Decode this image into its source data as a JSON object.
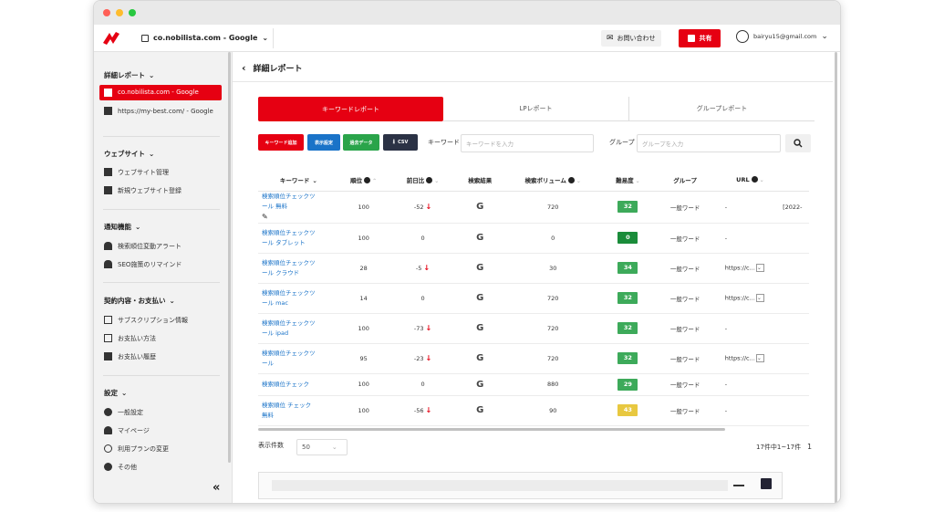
{
  "topbar": {
    "site_name": "co.nobilista.com - Google",
    "contact_label": "お問い合わせ",
    "share_label": "共有",
    "user_email": "bairyu15@gmail.com"
  },
  "sidebar": {
    "sections": [
      {
        "title": "詳細レポート",
        "items": [
          {
            "label": "co.nobilista.com - Google",
            "active": true
          },
          {
            "label": "https://my-best.com/ - Google",
            "active": false
          }
        ]
      },
      {
        "title": "ウェブサイト",
        "items": [
          {
            "label": "ウェブサイト管理"
          },
          {
            "label": "新規ウェブサイト登録"
          }
        ]
      },
      {
        "title": "通知機能",
        "items": [
          {
            "label": "検索順位変動アラート"
          },
          {
            "label": "SEO施策のリマインド"
          }
        ]
      },
      {
        "title": "契約内容・お支払い",
        "items": [
          {
            "label": "サブスクリプション情報"
          },
          {
            "label": "お支払い方法"
          },
          {
            "label": "お支払い履歴"
          }
        ]
      },
      {
        "title": "設定",
        "items": [
          {
            "label": "一般設定"
          },
          {
            "label": "マイページ"
          },
          {
            "label": "利用プランの変更"
          },
          {
            "label": "その他"
          }
        ]
      }
    ]
  },
  "main": {
    "title": "詳細レポート",
    "tabs": [
      "キーワードレポート",
      "LPレポート",
      "グループレポート"
    ],
    "buttons": {
      "add_keyword": "キーワード追加",
      "display_settings": "表示設定",
      "past_data": "過去データ",
      "csv": "CSV"
    },
    "filters": {
      "keyword_label": "キーワード",
      "keyword_placeholder": "キーワードを入力",
      "group_label": "グループ",
      "group_placeholder": "グループを入力"
    },
    "table": {
      "headers": [
        "キーワード",
        "順位",
        "前日比",
        "検索結果",
        "検索ボリューム",
        "難易度",
        "グループ",
        "URL"
      ],
      "rows": [
        {
          "kw1": "検索順位チェックツ",
          "kw2": "ール 無料",
          "rank": "100",
          "diff": "-52",
          "down": true,
          "volume": "720",
          "difficulty": "32",
          "dcolor": "#3daa5a",
          "group": "一般ワード",
          "url": "-",
          "extra": "[2022-"
        },
        {
          "kw1": "検索順位チェックツ",
          "kw2": "ール タブレット",
          "rank": "100",
          "diff": "0",
          "down": false,
          "volume": "0",
          "difficulty": "0",
          "dcolor": "#1a8c3a",
          "group": "一般ワード",
          "url": "-",
          "extra": ""
        },
        {
          "kw1": "検索順位チェックツ",
          "kw2": "ール クラウド",
          "rank": "28",
          "diff": "-5",
          "down": true,
          "volume": "30",
          "difficulty": "34",
          "dcolor": "#3daa5a",
          "group": "一般ワード",
          "url": "https://c...",
          "extra": ""
        },
        {
          "kw1": "検索順位チェックツ",
          "kw2": "ール mac",
          "rank": "14",
          "diff": "0",
          "down": false,
          "volume": "720",
          "difficulty": "32",
          "dcolor": "#3daa5a",
          "group": "一般ワード",
          "url": "https://c...",
          "extra": ""
        },
        {
          "kw1": "検索順位チェックツ",
          "kw2": "ール ipad",
          "rank": "100",
          "diff": "-73",
          "down": true,
          "volume": "720",
          "difficulty": "32",
          "dcolor": "#3daa5a",
          "group": "一般ワード",
          "url": "-",
          "extra": ""
        },
        {
          "kw1": "検索順位チェックツ",
          "kw2": "ール",
          "rank": "95",
          "diff": "-23",
          "down": true,
          "volume": "720",
          "difficulty": "32",
          "dcolor": "#3daa5a",
          "group": "一般ワード",
          "url": "https://c...",
          "extra": ""
        },
        {
          "kw1": "検索順位チェック",
          "kw2": "",
          "rank": "100",
          "diff": "0",
          "down": false,
          "volume": "880",
          "difficulty": "29",
          "dcolor": "#3daa5a",
          "group": "一般ワード",
          "url": "-",
          "extra": ""
        },
        {
          "kw1": "検索順位 チェック",
          "kw2": "無料",
          "rank": "100",
          "diff": "-56",
          "down": true,
          "volume": "90",
          "difficulty": "43",
          "dcolor": "#e8c840",
          "group": "一般ワード",
          "url": "-",
          "extra": ""
        }
      ]
    },
    "footer": {
      "per_page_label": "表示件数",
      "per_page_value": "50",
      "count_text": "17件中1~17件",
      "page": "1"
    }
  },
  "colors": {
    "accent": "#e60012",
    "blue_btn": "#1a73c8",
    "green_btn": "#2aa44a",
    "dark_btn": "#2b3245"
  }
}
